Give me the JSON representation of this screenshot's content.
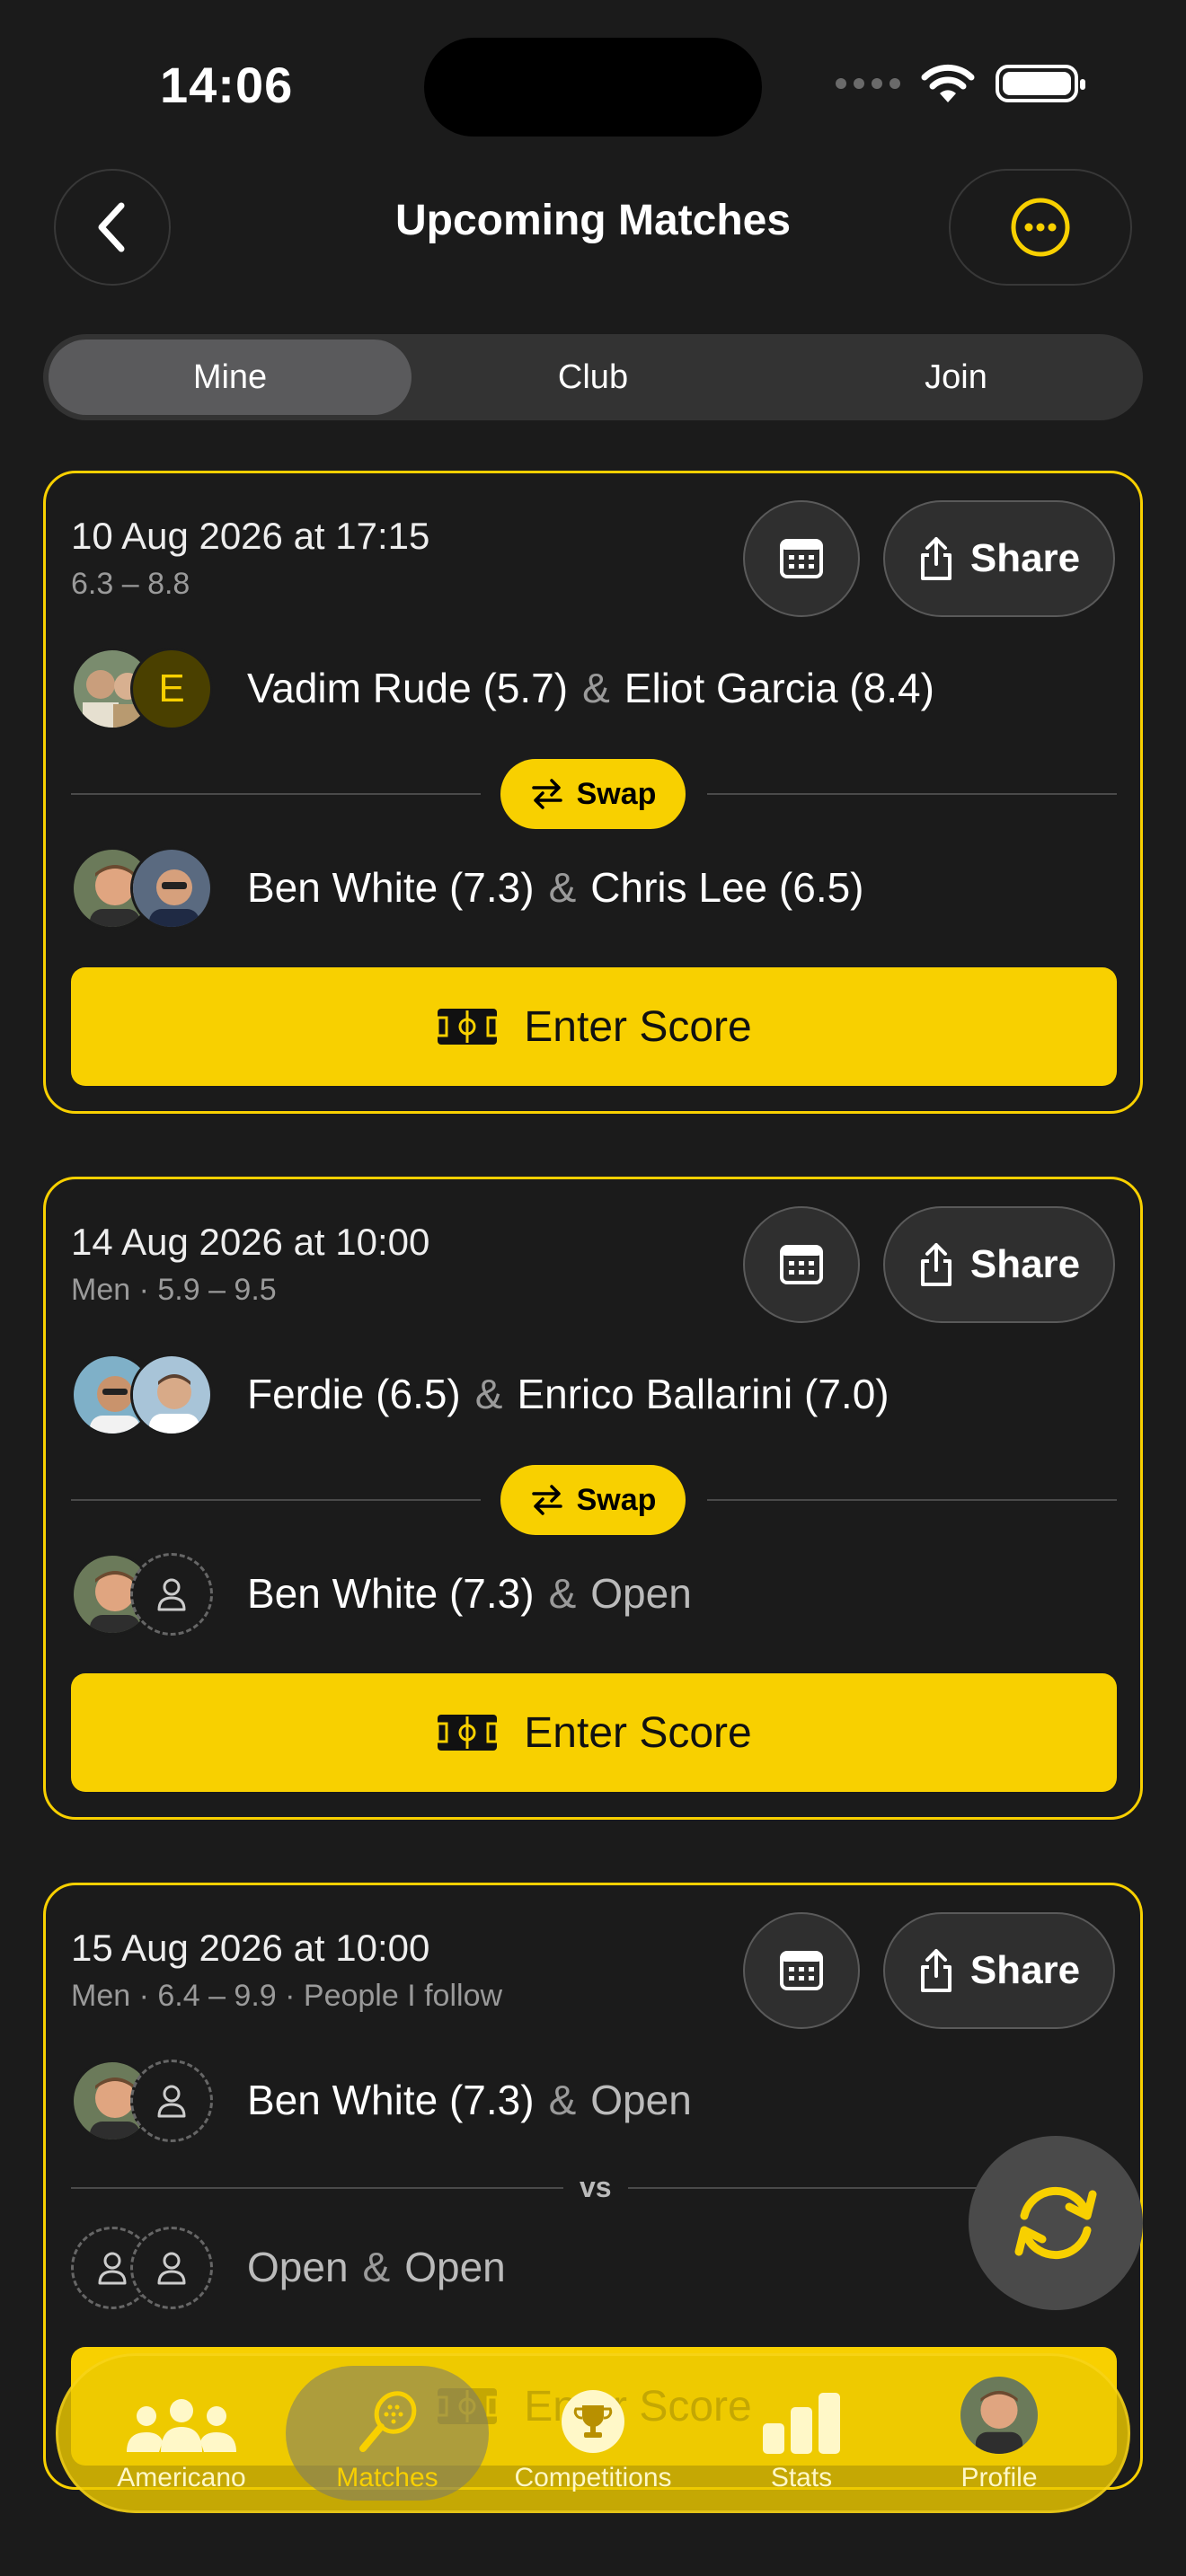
{
  "status_bar": {
    "time": "14:06"
  },
  "header": {
    "title": "Upcoming Matches"
  },
  "segments": [
    {
      "label": "Mine",
      "active": true
    },
    {
      "label": "Club",
      "active": false
    },
    {
      "label": "Join",
      "active": false
    }
  ],
  "share_label": "Share",
  "swap_label": "Swap",
  "enter_score_label": "Enter Score",
  "vs_label": "vs",
  "amp": "&",
  "matches": [
    {
      "datetime": "10 Aug 2026 at 17:15",
      "subtitle": "6.3 – 8.8",
      "team1": {
        "p1": "Vadim Rude (5.7)",
        "p2": "Eliot Garcia (8.4)",
        "p2_initial": "E"
      },
      "team2": {
        "p1": "Ben White (7.3)",
        "p2": "Chris Lee (6.5)"
      }
    },
    {
      "datetime": "14 Aug 2026 at 10:00",
      "subtitle": "Men · 5.9 – 9.5",
      "team1": {
        "p1": "Ferdie (6.5)",
        "p2": "Enrico Ballarini (7.0)"
      },
      "team2": {
        "p1": "Ben White (7.3)",
        "p2": "Open"
      }
    },
    {
      "datetime": "15 Aug 2026 at 10:00",
      "subtitle": "Men · 6.4 – 9.9 · People I follow",
      "team1": {
        "p1": "Ben White (7.3)",
        "p2": "Open"
      },
      "team2": {
        "p1": "Open",
        "p2": "Open"
      }
    }
  ],
  "tabbar": [
    {
      "label": "Americano",
      "icon": "group-icon"
    },
    {
      "label": "Matches",
      "icon": "racket-icon",
      "active": true
    },
    {
      "label": "Competitions",
      "icon": "trophy-icon"
    },
    {
      "label": "Stats",
      "icon": "bar-chart-icon"
    },
    {
      "label": "Profile",
      "icon": "avatar"
    }
  ],
  "colors": {
    "accent": "#f8d000",
    "background": "#1b1b1b"
  }
}
